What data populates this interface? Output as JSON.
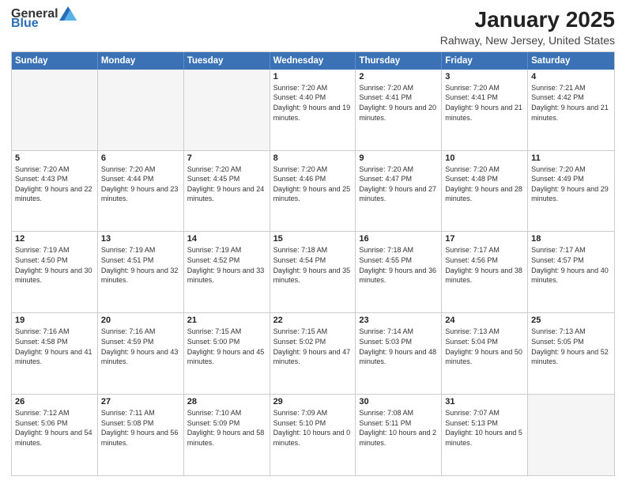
{
  "header": {
    "logo_general": "General",
    "logo_blue": "Blue",
    "month": "January 2025",
    "location": "Rahway, New Jersey, United States"
  },
  "days_of_week": [
    "Sunday",
    "Monday",
    "Tuesday",
    "Wednesday",
    "Thursday",
    "Friday",
    "Saturday"
  ],
  "weeks": [
    [
      {
        "day": "",
        "empty": true
      },
      {
        "day": "",
        "empty": true
      },
      {
        "day": "",
        "empty": true
      },
      {
        "day": "1",
        "sunrise": "7:20 AM",
        "sunset": "4:40 PM",
        "daylight": "9 hours and 19 minutes."
      },
      {
        "day": "2",
        "sunrise": "7:20 AM",
        "sunset": "4:41 PM",
        "daylight": "9 hours and 20 minutes."
      },
      {
        "day": "3",
        "sunrise": "7:20 AM",
        "sunset": "4:41 PM",
        "daylight": "9 hours and 21 minutes."
      },
      {
        "day": "4",
        "sunrise": "7:21 AM",
        "sunset": "4:42 PM",
        "daylight": "9 hours and 21 minutes."
      }
    ],
    [
      {
        "day": "5",
        "sunrise": "7:20 AM",
        "sunset": "4:43 PM",
        "daylight": "9 hours and 22 minutes."
      },
      {
        "day": "6",
        "sunrise": "7:20 AM",
        "sunset": "4:44 PM",
        "daylight": "9 hours and 23 minutes."
      },
      {
        "day": "7",
        "sunrise": "7:20 AM",
        "sunset": "4:45 PM",
        "daylight": "9 hours and 24 minutes."
      },
      {
        "day": "8",
        "sunrise": "7:20 AM",
        "sunset": "4:46 PM",
        "daylight": "9 hours and 25 minutes."
      },
      {
        "day": "9",
        "sunrise": "7:20 AM",
        "sunset": "4:47 PM",
        "daylight": "9 hours and 27 minutes."
      },
      {
        "day": "10",
        "sunrise": "7:20 AM",
        "sunset": "4:48 PM",
        "daylight": "9 hours and 28 minutes."
      },
      {
        "day": "11",
        "sunrise": "7:20 AM",
        "sunset": "4:49 PM",
        "daylight": "9 hours and 29 minutes."
      }
    ],
    [
      {
        "day": "12",
        "sunrise": "7:19 AM",
        "sunset": "4:50 PM",
        "daylight": "9 hours and 30 minutes."
      },
      {
        "day": "13",
        "sunrise": "7:19 AM",
        "sunset": "4:51 PM",
        "daylight": "9 hours and 32 minutes."
      },
      {
        "day": "14",
        "sunrise": "7:19 AM",
        "sunset": "4:52 PM",
        "daylight": "9 hours and 33 minutes."
      },
      {
        "day": "15",
        "sunrise": "7:18 AM",
        "sunset": "4:54 PM",
        "daylight": "9 hours and 35 minutes."
      },
      {
        "day": "16",
        "sunrise": "7:18 AM",
        "sunset": "4:55 PM",
        "daylight": "9 hours and 36 minutes."
      },
      {
        "day": "17",
        "sunrise": "7:17 AM",
        "sunset": "4:56 PM",
        "daylight": "9 hours and 38 minutes."
      },
      {
        "day": "18",
        "sunrise": "7:17 AM",
        "sunset": "4:57 PM",
        "daylight": "9 hours and 40 minutes."
      }
    ],
    [
      {
        "day": "19",
        "sunrise": "7:16 AM",
        "sunset": "4:58 PM",
        "daylight": "9 hours and 41 minutes."
      },
      {
        "day": "20",
        "sunrise": "7:16 AM",
        "sunset": "4:59 PM",
        "daylight": "9 hours and 43 minutes."
      },
      {
        "day": "21",
        "sunrise": "7:15 AM",
        "sunset": "5:00 PM",
        "daylight": "9 hours and 45 minutes."
      },
      {
        "day": "22",
        "sunrise": "7:15 AM",
        "sunset": "5:02 PM",
        "daylight": "9 hours and 47 minutes."
      },
      {
        "day": "23",
        "sunrise": "7:14 AM",
        "sunset": "5:03 PM",
        "daylight": "9 hours and 48 minutes."
      },
      {
        "day": "24",
        "sunrise": "7:13 AM",
        "sunset": "5:04 PM",
        "daylight": "9 hours and 50 minutes."
      },
      {
        "day": "25",
        "sunrise": "7:13 AM",
        "sunset": "5:05 PM",
        "daylight": "9 hours and 52 minutes."
      }
    ],
    [
      {
        "day": "26",
        "sunrise": "7:12 AM",
        "sunset": "5:06 PM",
        "daylight": "9 hours and 54 minutes."
      },
      {
        "day": "27",
        "sunrise": "7:11 AM",
        "sunset": "5:08 PM",
        "daylight": "9 hours and 56 minutes."
      },
      {
        "day": "28",
        "sunrise": "7:10 AM",
        "sunset": "5:09 PM",
        "daylight": "9 hours and 58 minutes."
      },
      {
        "day": "29",
        "sunrise": "7:09 AM",
        "sunset": "5:10 PM",
        "daylight": "10 hours and 0 minutes."
      },
      {
        "day": "30",
        "sunrise": "7:08 AM",
        "sunset": "5:11 PM",
        "daylight": "10 hours and 2 minutes."
      },
      {
        "day": "31",
        "sunrise": "7:07 AM",
        "sunset": "5:13 PM",
        "daylight": "10 hours and 5 minutes."
      },
      {
        "day": "",
        "empty": true
      }
    ]
  ]
}
